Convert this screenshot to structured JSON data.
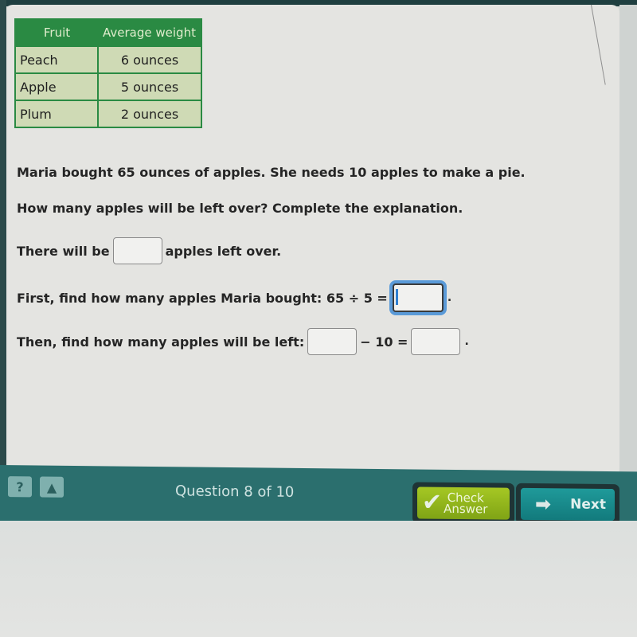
{
  "table": {
    "headers": [
      "Fruit",
      "Average weight"
    ],
    "rows": [
      {
        "fruit": "Peach",
        "weight": "6 ounces"
      },
      {
        "fruit": "Apple",
        "weight": "5 ounces"
      },
      {
        "fruit": "Plum",
        "weight": "2 ounces"
      }
    ]
  },
  "question": {
    "line1": "Maria bought 65 ounces of apples. She needs 10 apples to make a pie.",
    "line2": "How many apples will be left over? Complete the explanation.",
    "line3_prefix": "There will be",
    "line3_suffix": "apples left over.",
    "line4_prefix": "First, find how many apples Maria bought: 65 ÷ 5 =",
    "line5_prefix": "Then, find how many apples will be left:",
    "line5_middle": "− 10 =",
    "period": "."
  },
  "inputs": {
    "leftover_value": "",
    "bought_value": "",
    "apples_value": "",
    "left_value": ""
  },
  "toolbar": {
    "help_label": "?",
    "report_label": "▲",
    "question_counter": "Question 8 of 10",
    "check_line1": "Check",
    "check_line2": "Answer",
    "check_icon": "✔",
    "next_label": "Next",
    "next_icon": "➡"
  },
  "colors": {
    "table_header": "#2a8a43",
    "table_cell": "#cfdab5",
    "toolbar": "#2b6f6e",
    "check_button": "#a6c824",
    "next_button": "#1f9a9a",
    "focus_ring": "#5a9ad8"
  }
}
